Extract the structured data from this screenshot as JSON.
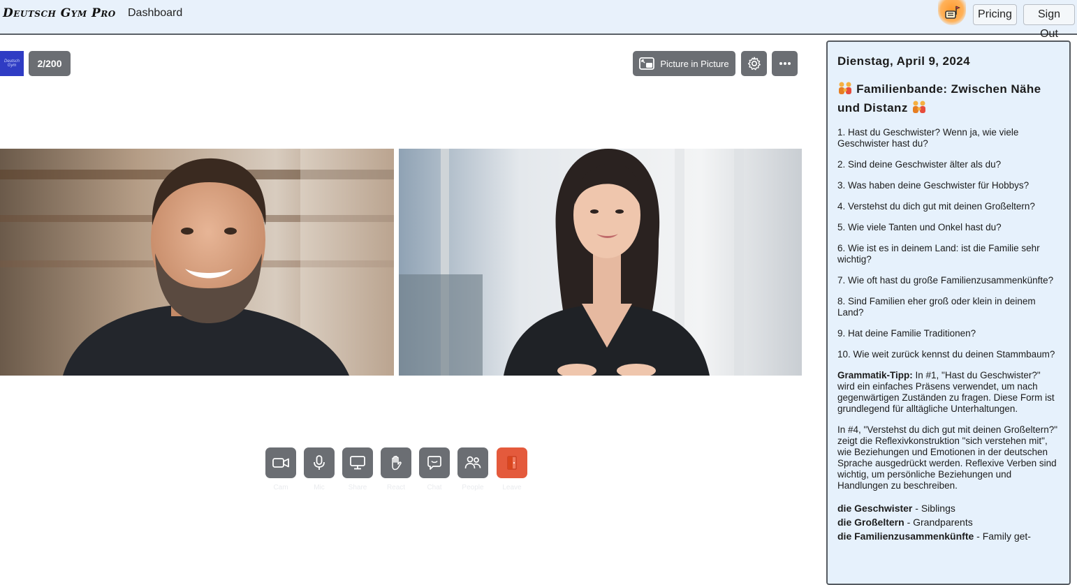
{
  "header": {
    "brand": "Deutsch Gym Pro",
    "nav_dashboard": "Dashboard",
    "pricing_label": "Pricing",
    "signout_label": "Sign Out",
    "flag_icon": "flag-hand-icon",
    "flag_color": "#ff9a2e"
  },
  "meeting": {
    "logo_text": "Deutsch Gym",
    "participant_count": "2/200",
    "pip_label": "Picture in Picture",
    "controls": [
      {
        "id": "cam",
        "label": "Cam",
        "icon": "camera-icon"
      },
      {
        "id": "mic",
        "label": "Mic",
        "icon": "microphone-icon"
      },
      {
        "id": "share",
        "label": "Share",
        "icon": "screen-share-icon"
      },
      {
        "id": "react",
        "label": "React",
        "icon": "hand-icon"
      },
      {
        "id": "chat",
        "label": "Chat",
        "icon": "chat-icon"
      },
      {
        "id": "people",
        "label": "People",
        "icon": "people-icon"
      },
      {
        "id": "leave",
        "label": "Leave",
        "icon": "leave-door-icon"
      }
    ],
    "leave_color": "#e45a3c"
  },
  "panel": {
    "date": "Dienstag, April 9, 2024",
    "topic": "Familienbande: Zwischen Nähe und Distanz",
    "questions": [
      "1. Hast du Geschwister? Wenn ja, wie viele Geschwister hast du?",
      "2. Sind deine Geschwister älter als du?",
      "3. Was haben deine Geschwister für Hobbys?",
      "4. Verstehst du dich gut mit deinen Großeltern?",
      "5. Wie viele Tanten und Onkel hast du?",
      "6. Wie ist es in deinem Land: ist die Familie sehr wichtig?",
      "7. Wie oft hast du große Familienzusammenkünfte?",
      "8. Sind Familien eher groß oder klein in deinem Land?",
      "9. Hat deine Familie Traditionen?",
      "10. Wie weit zurück kennst du deinen Stammbaum?"
    ],
    "grammar_label": "Grammatik-Tipp:",
    "grammar_text_1": " In #1, \"Hast du Geschwister?\" wird ein einfaches Präsens verwendet, um nach gegenwärtigen Zuständen zu fragen. Diese Form ist grundlegend für alltägliche Unterhaltungen.",
    "grammar_text_2": "In #4, \"Verstehst du dich gut mit deinen Großeltern?\" zeigt die Reflexivkonstruktion \"sich verstehen mit\", wie Beziehungen und Emotionen in der deutschen Sprache ausgedrückt werden. Reflexive Verben sind wichtig, um persönliche Beziehungen und Handlungen zu beschreiben.",
    "vocab": [
      {
        "term": "die Geschwister",
        "meaning": " - Siblings"
      },
      {
        "term": "die Großeltern",
        "meaning": " - Grandparents"
      },
      {
        "term": "die Familienzusammenkünfte",
        "meaning": " - Family get-"
      }
    ]
  }
}
